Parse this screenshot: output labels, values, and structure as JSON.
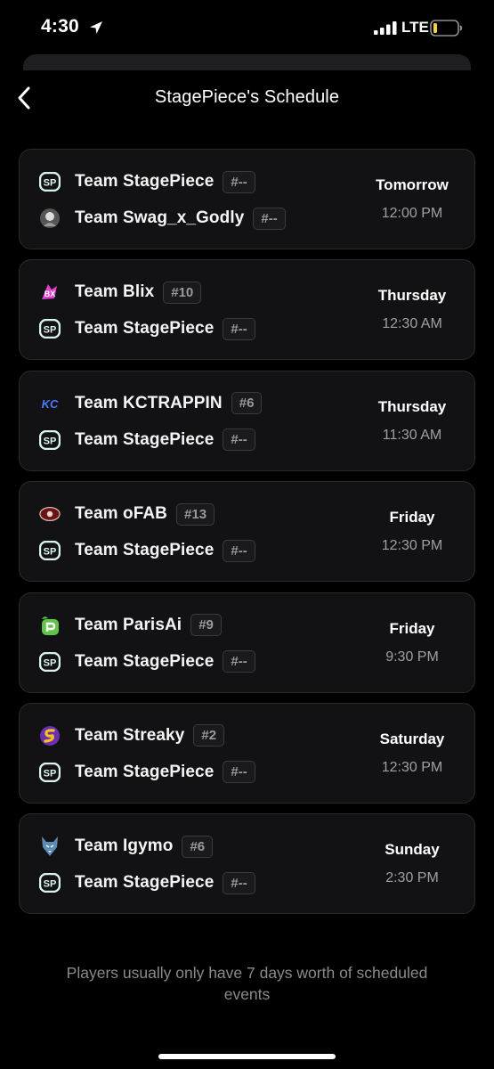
{
  "status_bar": {
    "time": "4:30",
    "network": "LTE",
    "battery_color": "#f5d33a",
    "icons": [
      "location-arrow-icon",
      "signal-bars-icon",
      "battery-icon"
    ]
  },
  "header": {
    "title": "StagePiece's Schedule",
    "back_icon": "chevron-left-icon"
  },
  "colors": {
    "background": "#000000",
    "card": "#121214",
    "card_border": "#2a2a2d",
    "badge_text": "#9a9a9e",
    "time_text": "#a0a0a4"
  },
  "matches": [
    {
      "team1": {
        "name": "Team StagePiece",
        "rank": "#--",
        "logo": "stagepiece-logo-icon"
      },
      "team2": {
        "name": "Team Swag_x_Godly",
        "rank": "#--",
        "logo": "swag-godly-logo-icon"
      },
      "day": "Tomorrow",
      "time": "12:00 PM"
    },
    {
      "team1": {
        "name": "Team Blix",
        "rank": "#10",
        "logo": "blix-logo-icon"
      },
      "team2": {
        "name": "Team StagePiece",
        "rank": "#--",
        "logo": "stagepiece-logo-icon"
      },
      "day": "Thursday",
      "time": "12:30 AM"
    },
    {
      "team1": {
        "name": "Team KCTRAPPIN",
        "rank": "#6",
        "logo": "kctrappin-logo-icon"
      },
      "team2": {
        "name": "Team StagePiece",
        "rank": "#--",
        "logo": "stagepiece-logo-icon"
      },
      "day": "Thursday",
      "time": "11:30 AM"
    },
    {
      "team1": {
        "name": "Team oFAB",
        "rank": "#13",
        "logo": "ofab-logo-icon"
      },
      "team2": {
        "name": "Team StagePiece",
        "rank": "#--",
        "logo": "stagepiece-logo-icon"
      },
      "day": "Friday",
      "time": "12:30 PM"
    },
    {
      "team1": {
        "name": "Team ParisAi",
        "rank": "#9",
        "logo": "parisai-logo-icon"
      },
      "team2": {
        "name": "Team StagePiece",
        "rank": "#--",
        "logo": "stagepiece-logo-icon"
      },
      "day": "Friday",
      "time": "9:30 PM"
    },
    {
      "team1": {
        "name": "Team Streaky",
        "rank": "#2",
        "logo": "streaky-logo-icon"
      },
      "team2": {
        "name": "Team StagePiece",
        "rank": "#--",
        "logo": "stagepiece-logo-icon"
      },
      "day": "Saturday",
      "time": "12:30 PM"
    },
    {
      "team1": {
        "name": "Team Igymo",
        "rank": "#6",
        "logo": "igymo-logo-icon"
      },
      "team2": {
        "name": "Team StagePiece",
        "rank": "#--",
        "logo": "stagepiece-logo-icon"
      },
      "day": "Sunday",
      "time": "2:30 PM"
    }
  ],
  "footer": {
    "note": "Players usually only have 7 days worth of scheduled events"
  }
}
